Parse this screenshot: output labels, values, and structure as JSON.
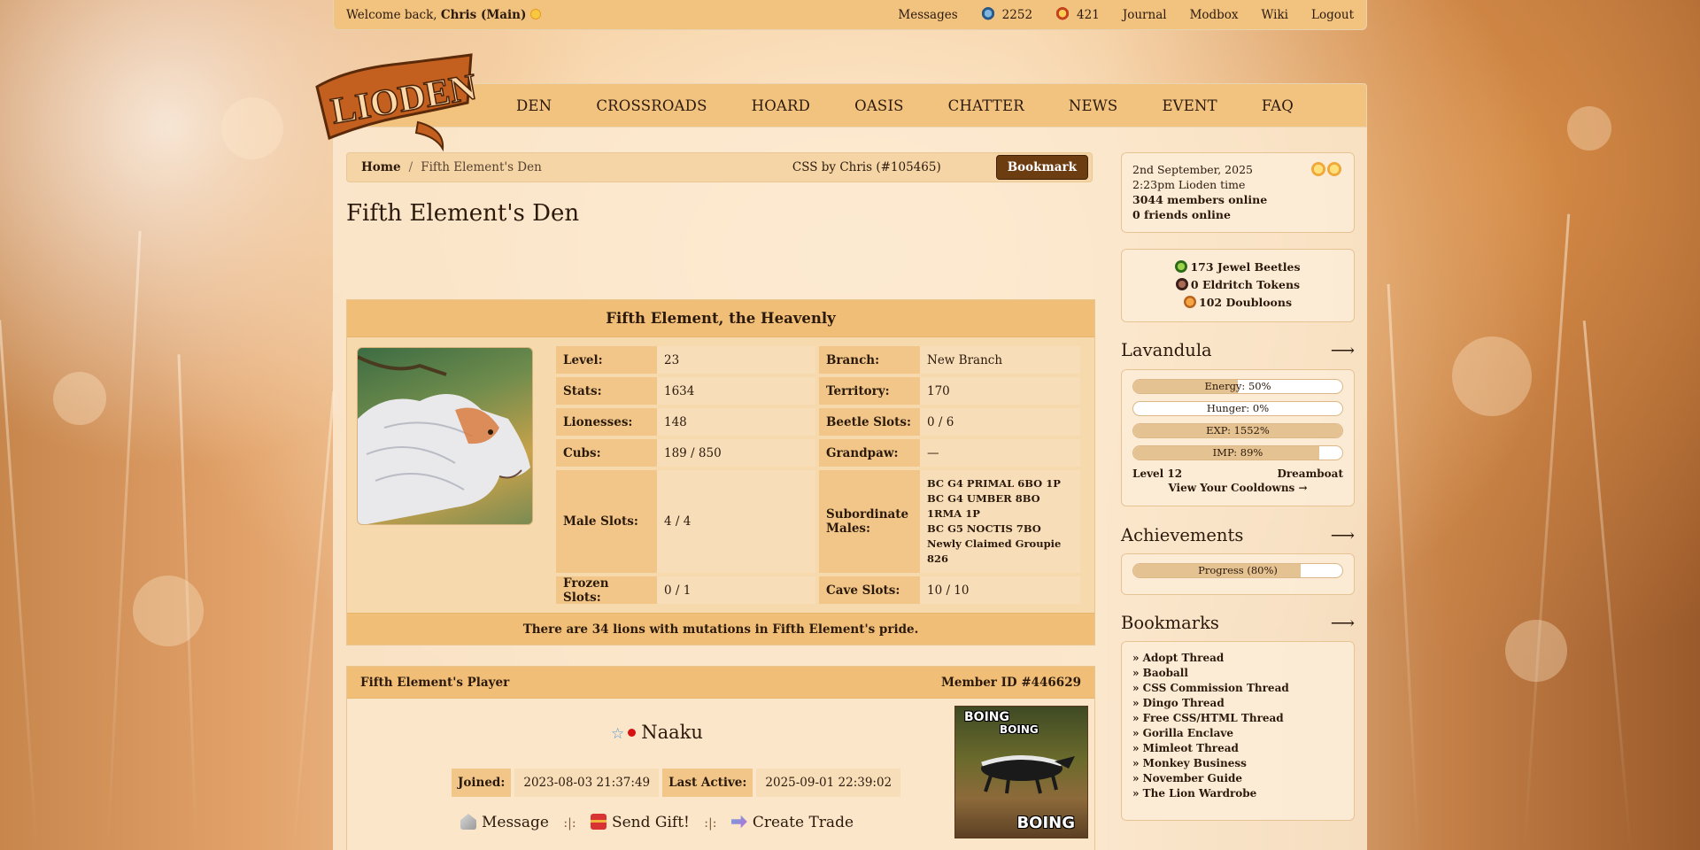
{
  "topbar": {
    "welcome_prefix": "Welcome back,",
    "user": "Chris (Main)",
    "links": {
      "messages": "Messages",
      "beetles": "2252",
      "coins": "421",
      "journal": "Journal",
      "modbox": "Modbox",
      "wiki": "Wiki",
      "logout": "Logout"
    }
  },
  "logo_text": "LIODEN",
  "nav": [
    "DEN",
    "CROSSROADS",
    "HOARD",
    "OASIS",
    "CHATTER",
    "NEWS",
    "EVENT",
    "FAQ"
  ],
  "breadcrumb": {
    "home": "Home",
    "separator": "/",
    "current": "Fifth Element's Den",
    "css_credit": "CSS by Chris (#105465)",
    "bookmark": "Bookmark"
  },
  "page_title": "Fifth Element's Den",
  "den": {
    "heading": "Fifth Element, the Heavenly",
    "stats": {
      "level_k": "Level:",
      "level_v": "23",
      "branch_k": "Branch:",
      "branch_v": "New Branch",
      "stats_k": "Stats:",
      "stats_v": "1634",
      "territory_k": "Territory:",
      "territory_v": "170",
      "lionesses_k": "Lionesses:",
      "lionesses_v": "148",
      "beetle_k": "Beetle Slots:",
      "beetle_v": "0 / 6",
      "cubs_k": "Cubs:",
      "cubs_v": "189 / 850",
      "grandpaw_k": "Grandpaw:",
      "grandpaw_v": "—",
      "male_k": "Male Slots:",
      "male_v": "4 / 4",
      "sub_k": "Subordinate Males:",
      "sub_males": [
        "BC G4 PRIMAL 6BO 1P",
        "BC G4 UMBER 8BO 1RMA 1P",
        "BC G5 NOCTIS 7BO",
        "Newly Claimed Groupie 826"
      ],
      "frozen_k": "Frozen Slots:",
      "frozen_v": "0 / 1",
      "cave_k": "Cave Slots:",
      "cave_v": "10 / 10"
    },
    "footer": "There are 34 lions with mutations in Fifth Element's pride."
  },
  "player": {
    "heading": "Fifth Element's Player",
    "member_id": "Member ID #446629",
    "name": "Naaku",
    "joined_k": "Joined:",
    "joined_v": "2023-08-03 21:37:49",
    "active_k": "Last Active:",
    "active_v": "2025-09-01 22:39:02",
    "message": "Message",
    "gift": "Send Gift!",
    "trade": "Create Trade",
    "divider": ":|:",
    "avatar_text": {
      "t1": "BOING",
      "t2": "BOING",
      "t3": "BOING"
    }
  },
  "sidebar": {
    "date": "2nd September, 2025",
    "time": "2:23pm Lioden time",
    "members": "3044 members online",
    "friends": "0 friends online",
    "currency": {
      "jewel": "173 Jewel Beetles",
      "eldritch": "0 Eldritch Tokens",
      "doubloons": "102 Doubloons"
    },
    "lavandula": {
      "title": "Lavandula",
      "arrow": "⟶",
      "bars": [
        {
          "label": "Energy: 50%",
          "value": 50
        },
        {
          "label": "Hunger: 0%",
          "value": 0
        },
        {
          "label": "EXP: 1552%",
          "value": 100
        },
        {
          "label": "IMP: 89%",
          "value": 89
        }
      ],
      "level": "Level 12",
      "name": "Dreamboat",
      "cooldowns": "View Your Cooldowns →"
    },
    "achievements": {
      "title": "Achievements",
      "arrow": "⟶",
      "progress_label": "Progress (80%)",
      "progress": 80
    },
    "bookmarks": {
      "title": "Bookmarks",
      "arrow": "⟶",
      "items": [
        "» Adopt Thread",
        "» Baoball",
        "» CSS Commission Thread",
        "» Dingo Thread",
        "» Free CSS/HTML Thread",
        "» Gorilla Enclave",
        "» Mimleot Thread",
        "» Monkey Business",
        "» November Guide",
        "» The Lion Wardrobe"
      ]
    }
  }
}
